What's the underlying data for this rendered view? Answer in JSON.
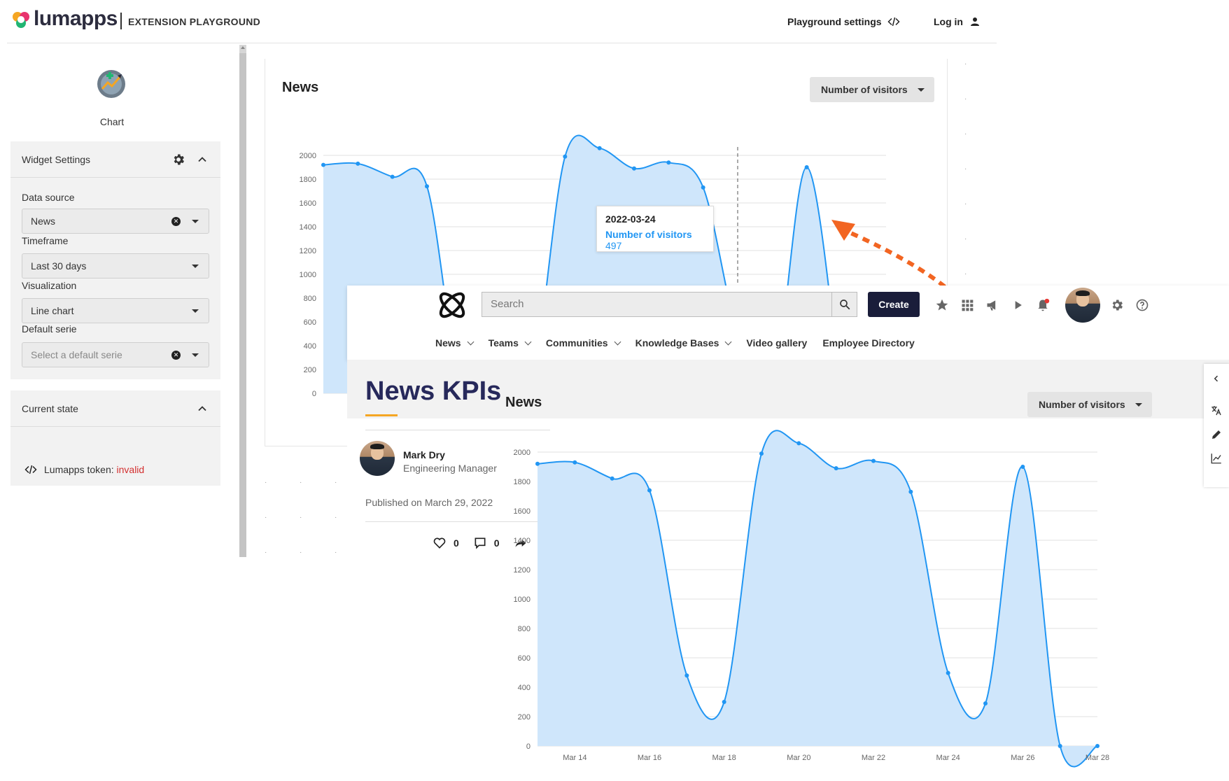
{
  "playground": {
    "brand": "lumapps",
    "subtitle": "EXTENSION PLAYGROUND",
    "settings_link": "Playground settings",
    "login_link": "Log in"
  },
  "left_panel": {
    "widget_name": "Chart",
    "widget_settings_title": "Widget Settings",
    "fields": {
      "data_source_label": "Data source",
      "data_source_value": "News",
      "timeframe_label": "Timeframe",
      "timeframe_value": "Last 30 days",
      "visualization_label": "Visualization",
      "visualization_value": "Line chart",
      "default_serie_label": "Default serie",
      "default_serie_placeholder": "Select a default serie"
    },
    "current_state_title": "Current state",
    "token_label": "Lumapps token:",
    "token_status": "invalid"
  },
  "back_card": {
    "title": "News",
    "metric_button": "Number of visitors",
    "tooltip": {
      "date": "2022-03-24",
      "metric": "Number of visitors",
      "value": "497"
    }
  },
  "intranet": {
    "search_placeholder": "Search",
    "create_button": "Create",
    "menu": [
      {
        "label": "News",
        "has_dropdown": true
      },
      {
        "label": "Teams",
        "has_dropdown": true
      },
      {
        "label": "Communities",
        "has_dropdown": true
      },
      {
        "label": "Knowledge Bases",
        "has_dropdown": true
      },
      {
        "label": "Video gallery",
        "has_dropdown": false
      },
      {
        "label": "Employee Directory",
        "has_dropdown": false
      }
    ],
    "page_title": "News KPIs",
    "author": {
      "name": "Mark Dry",
      "role": "Engineering Manager",
      "published": "Published on March 29, 2022",
      "likes": "0",
      "comments": "0"
    },
    "widget": {
      "title": "News",
      "metric_button": "Number of visitors"
    }
  },
  "colors": {
    "series": "#2196f3",
    "fill": "#cfe6fb",
    "accent": "#f26522",
    "navy": "#1a1d3a",
    "title": "#27295b"
  },
  "chart_data": [
    {
      "type": "area",
      "title": "News",
      "series": [
        {
          "name": "Number of visitors",
          "values": [
            1920,
            1930,
            1820,
            1740,
            0,
            0,
            0,
            1990,
            2060,
            1890,
            1940,
            1730,
            497,
            0,
            1900,
            0
          ]
        }
      ],
      "ylim": [
        0,
        2000
      ],
      "yticks": [
        0,
        200,
        400,
        600,
        800,
        1000,
        1200,
        1400,
        1600,
        1800,
        2000
      ],
      "hover_date": "2022-03-24"
    },
    {
      "type": "area",
      "title": "News",
      "x": [
        "Mar 13",
        "Mar 14",
        "Mar 15",
        "Mar 16",
        "Mar 17",
        "Mar 18",
        "Mar 19",
        "Mar 20",
        "Mar 21",
        "Mar 22",
        "Mar 23",
        "Mar 24",
        "Mar 25",
        "Mar 26",
        "Mar 27",
        "Mar 28"
      ],
      "x_tick_labels": [
        "Mar 14",
        "Mar 16",
        "Mar 18",
        "Mar 20",
        "Mar 22",
        "Mar 24",
        "Mar 26",
        "Mar 28"
      ],
      "series": [
        {
          "name": "Number of visitors",
          "values": [
            1920,
            1930,
            1820,
            1740,
            480,
            300,
            1990,
            2060,
            1890,
            1940,
            1730,
            497,
            290,
            1900,
            0,
            0
          ]
        }
      ],
      "ylim": [
        0,
        2000
      ],
      "yticks": [
        0,
        200,
        400,
        600,
        800,
        1000,
        1200,
        1400,
        1600,
        1800,
        2000
      ]
    }
  ]
}
